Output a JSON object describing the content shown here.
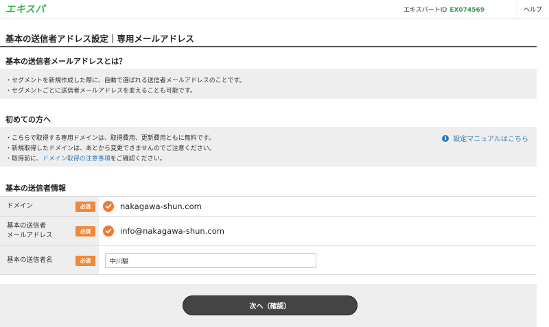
{
  "header": {
    "logo_text": "エキスパ",
    "partner_id_label": "エキスパートID",
    "partner_id": "EX074569",
    "help_label": "ヘルプ"
  },
  "page_title": "基本の送信者アドレス設定｜専用メールアドレス",
  "about": {
    "heading": "基本の送信者メールアドレスとは？",
    "lines": [
      "・セグメントを新規作成した際に、自動で選ばれる送信者メールアドレスのことです。",
      "・セグメントごとに送信者メールアドレスを変えることも可能です。"
    ]
  },
  "first_time": {
    "heading": "初めての方へ",
    "lines": [
      "・こちらで取得する専用ドメインは、取得費用、更新費用ともに無料です。",
      "・新規取得したドメインは、あとから変更できませんのでご注意ください。"
    ],
    "line3_prefix": "・取得前に、",
    "line3_link": "ドメイン取得の注意事項",
    "line3_suffix": "をご確認ください。",
    "manual_link": "設定マニュアルはこちら"
  },
  "sender_info": {
    "heading": "基本の送信者情報",
    "required_badge": "必須",
    "domain_label": "ドメイン",
    "domain_value": "nakagawa-shun.com",
    "email_label_line1": "基本の送信者",
    "email_label_line2": "メールアドレス",
    "email_value": "info@nakagawa-shun.com",
    "name_label": "基本の送信者名",
    "name_value": "中川駿"
  },
  "next_button": "次へ（確認）",
  "colors": {
    "brand_green": "#35b24a",
    "accent_orange": "#ef7a2e",
    "link_blue": "#2d7bbf",
    "button_dark": "#444444"
  }
}
